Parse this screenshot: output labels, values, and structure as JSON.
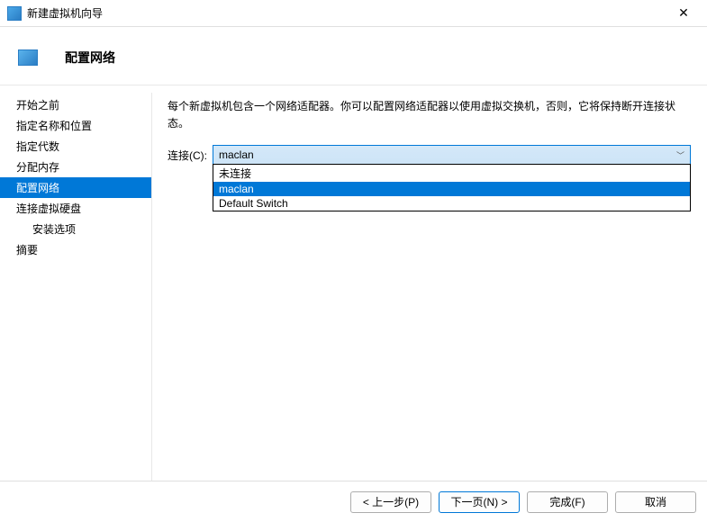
{
  "window": {
    "title": "新建虚拟机向导"
  },
  "header": {
    "title": "配置网络"
  },
  "sidebar": {
    "items": [
      {
        "label": "开始之前",
        "selected": false,
        "indent": false
      },
      {
        "label": "指定名称和位置",
        "selected": false,
        "indent": false
      },
      {
        "label": "指定代数",
        "selected": false,
        "indent": false
      },
      {
        "label": "分配内存",
        "selected": false,
        "indent": false
      },
      {
        "label": "配置网络",
        "selected": true,
        "indent": false
      },
      {
        "label": "连接虚拟硬盘",
        "selected": false,
        "indent": false
      },
      {
        "label": "安装选项",
        "selected": false,
        "indent": true
      },
      {
        "label": "摘要",
        "selected": false,
        "indent": false
      }
    ]
  },
  "main": {
    "description": "每个新虚拟机包含一个网络适配器。你可以配置网络适配器以使用虚拟交换机，否则，它将保持断开连接状态。",
    "connection_label": "连接(C):",
    "connection_value": "maclan",
    "dropdown_options": [
      {
        "label": "未连接",
        "highlight": false
      },
      {
        "label": "maclan",
        "highlight": true
      },
      {
        "label": "Default Switch",
        "highlight": false
      }
    ]
  },
  "footer": {
    "prev": "< 上一步(P)",
    "next": "下一页(N) >",
    "finish": "完成(F)",
    "cancel": "取消"
  }
}
